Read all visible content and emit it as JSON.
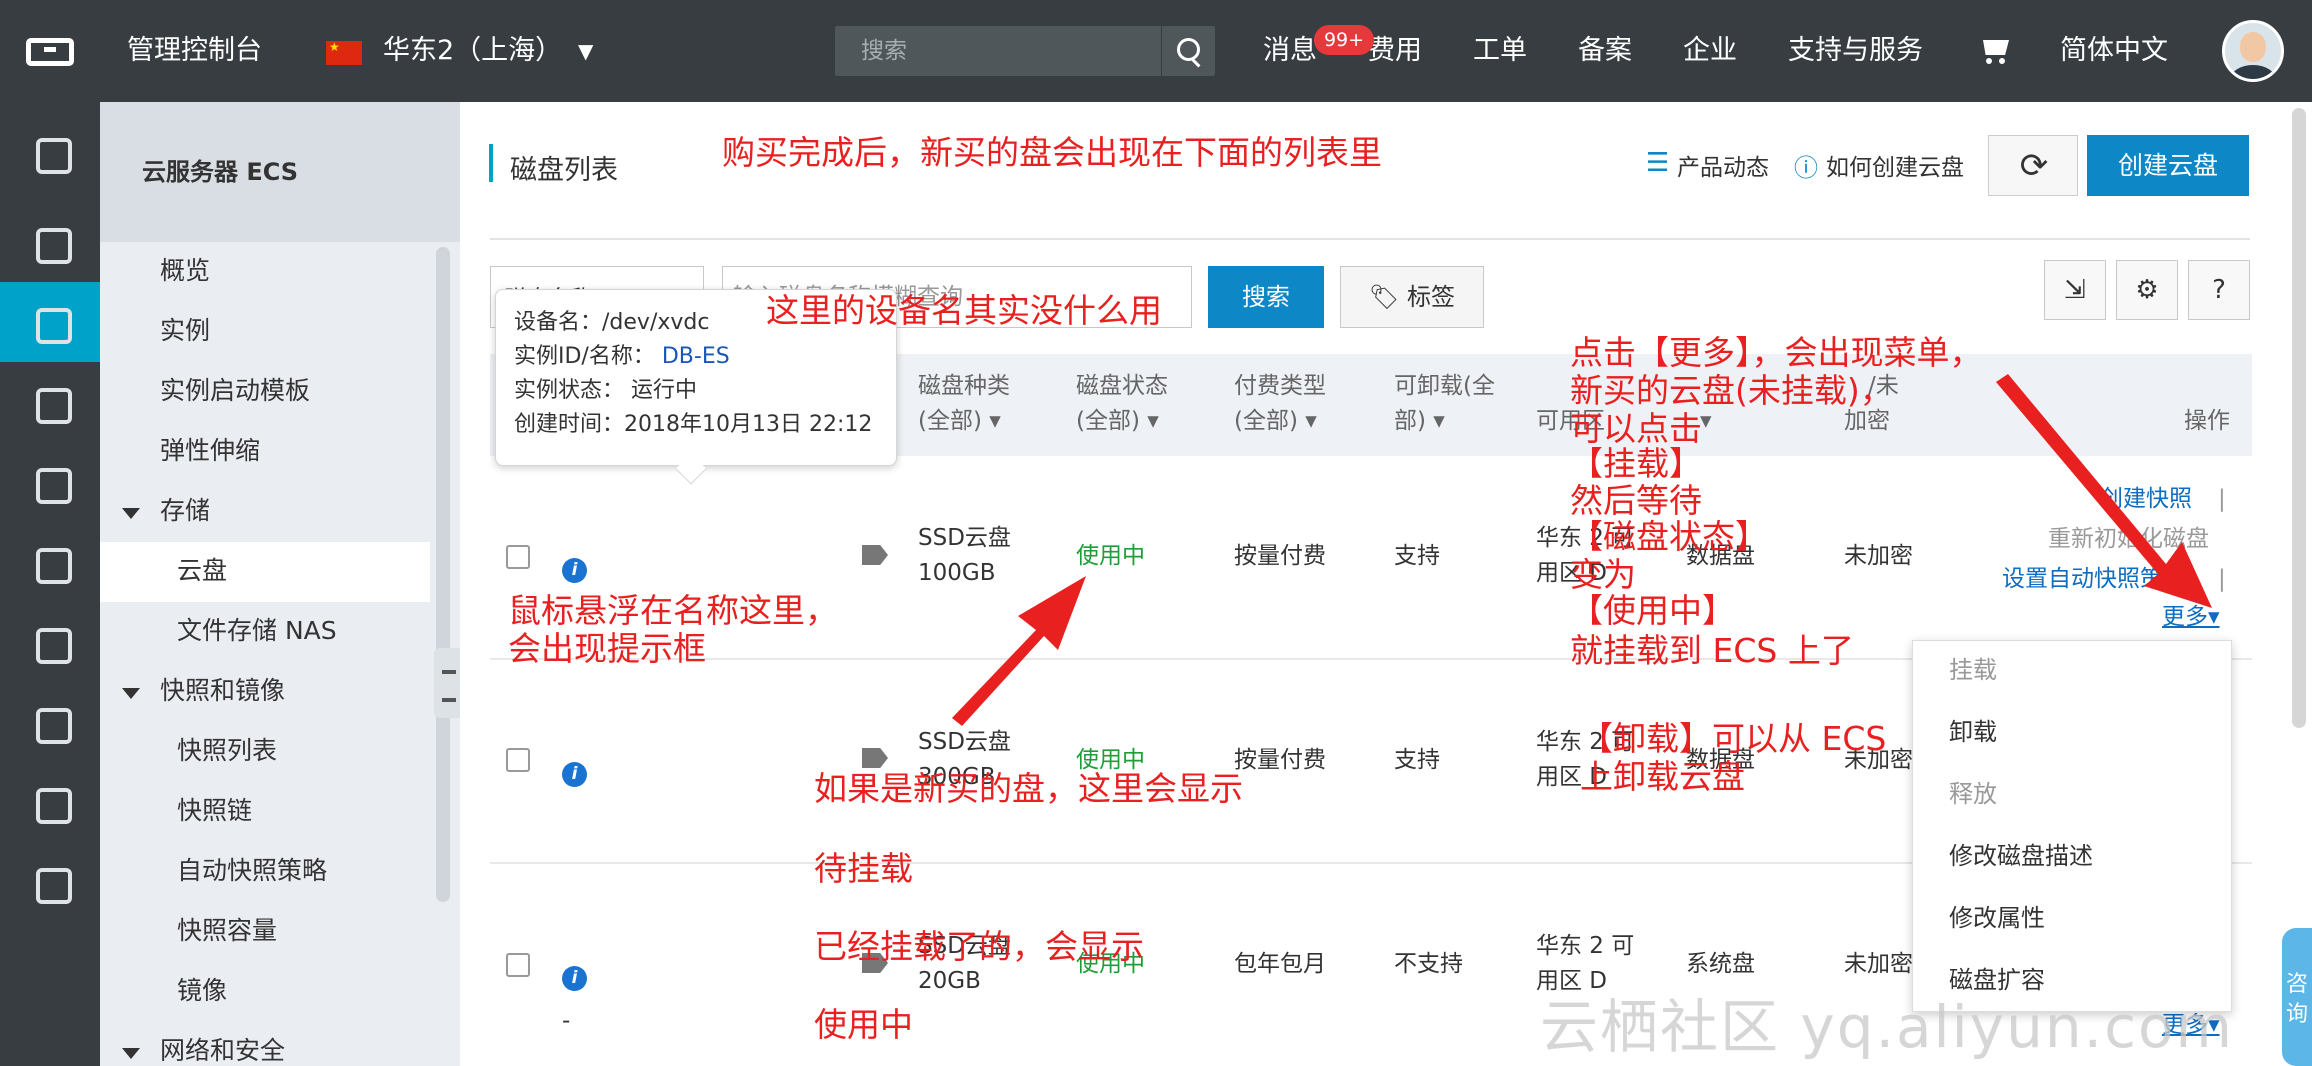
{
  "topbar": {
    "console": "管理控制台",
    "region": "华东2（上海）",
    "search_placeholder": "搜索",
    "messages": "消息",
    "messages_badge": "99+",
    "nav": [
      "费用",
      "工单",
      "备案",
      "企业",
      "支持与服务"
    ],
    "language": "简体中文"
  },
  "sidebar": {
    "title": "云服务器 ECS",
    "items": [
      "概览",
      "实例",
      "实例启动模板",
      "弹性伸缩"
    ],
    "storage": "存储",
    "storage_items": [
      "云盘",
      "文件存储 NAS"
    ],
    "snapshots": "快照和镜像",
    "snapshot_items": [
      "快照列表",
      "快照链",
      "自动快照策略",
      "快照容量",
      "镜像"
    ],
    "network": "网络和安全"
  },
  "header": {
    "title": "磁盘列表",
    "product_news": "产品动态",
    "how_to_create": "如何创建云盘",
    "create_button": "创建云盘"
  },
  "filter": {
    "select_value": "磁盘名称",
    "input_placeholder": "输入磁盘名称模糊查询",
    "search_button": "搜索",
    "tags_button": "标签"
  },
  "table": {
    "headers": {
      "disk_type": [
        "磁盘种类",
        "(全部)"
      ],
      "disk_status": [
        "磁盘状态",
        "(全部)"
      ],
      "pay_type": [
        "付费类型",
        "(全部)"
      ],
      "detachable": [
        "可卸载(全",
        "部)"
      ],
      "zone": "可用区",
      "encrypt": "加密",
      "attr_partial": "/未",
      "actions": "操作"
    },
    "rows": [
      {
        "type": [
          "SSD云盘",
          "100GB"
        ],
        "status": "使用中",
        "pay": "按量付费",
        "detach": "支持",
        "zone": [
          "华东 2 可",
          "用区 D"
        ],
        "attr": "数据盘",
        "encrypt": "未加密"
      },
      {
        "type": [
          "SSD云盘",
          "300GB"
        ],
        "status": "使用中",
        "pay": "按量付费",
        "detach": "支持",
        "zone": [
          "华东 2 可",
          "用区 D"
        ],
        "attr": "数据盘",
        "encrypt": "未加密"
      },
      {
        "type": [
          "SSD云盘",
          "20GB"
        ],
        "status": "使用中",
        "pay": "包年包月",
        "detach": "不支持",
        "zone": [
          "华东 2 可",
          "用区 D"
        ],
        "attr": "系统盘",
        "encrypt": "未加密",
        "dash": "-"
      }
    ],
    "row1_actions": {
      "snapshot": "创建快照",
      "reinit": "重新初始化磁盘",
      "auto_policy": "设置自动快照策略",
      "more": "更多"
    },
    "more": "更多"
  },
  "tooltip": {
    "device_label": "设备名：",
    "device_value": "/dev/xvdc",
    "instance_label": "实例ID/名称：",
    "instance_value": "DB-ES",
    "state_label": "实例状态：",
    "state_value": "运行中",
    "created_label": "创建时间：",
    "created_value": "2018年10月13日 22:12"
  },
  "dropdown": [
    "挂载",
    "卸载",
    "释放",
    "修改磁盘描述",
    "修改属性",
    "磁盘扩容"
  ],
  "annotations": {
    "top": "购买完成后，新买的盘会出现在下面的列表里",
    "device_name": "这里的设备名其实没什么用",
    "hover": [
      "鼠标悬浮在名称这里，",
      "会出现提示框"
    ],
    "more_menu": [
      "点击【更多】，会出现菜单，",
      "新买的云盘(未挂载)，",
      "可以点击",
      "【挂载】",
      "然后等待",
      "【磁盘状态】",
      "变为",
      "【使用中】",
      "就挂载到 ECS 上了"
    ],
    "unmount": [
      "【卸载】可以从 ECS",
      "上卸载云盘"
    ],
    "status_new": "如果是新买的盘，这里会显示",
    "status_pending": "待挂载",
    "status_mounted": "已经挂载了的，会显示",
    "status_in_use": "使用中"
  },
  "consult": "咨询",
  "watermark": "云栖社区 yq.aliyun.com",
  "colors": {
    "accent": "#00a2ca",
    "primary_button": "#0e87c6",
    "annotation": "#e8201f",
    "topbar": "#373d41"
  }
}
